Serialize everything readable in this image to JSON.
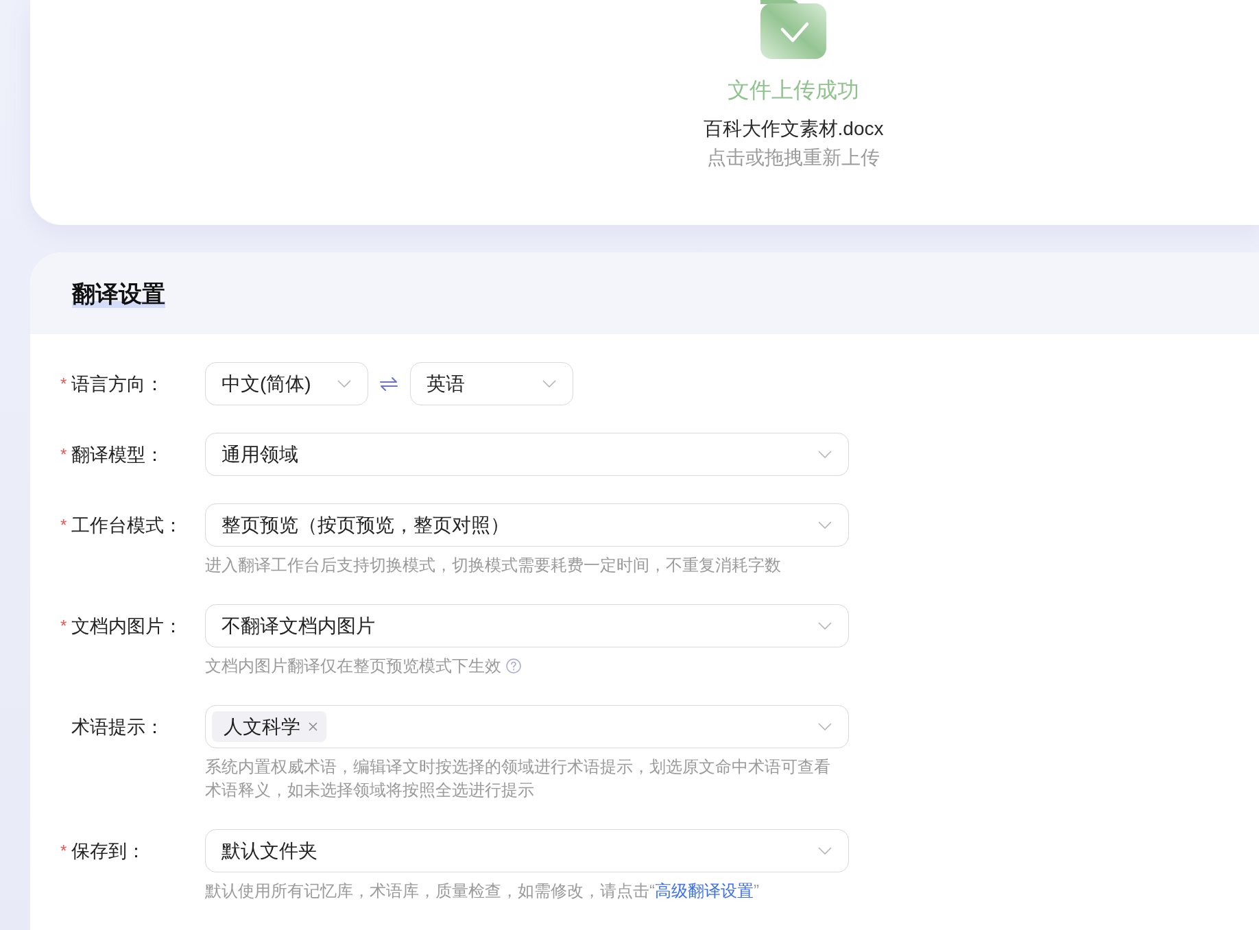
{
  "upload": {
    "status": "文件上传成功",
    "file_name": "百科大作文素材.docx",
    "hint": "点击或拖拽重新上传"
  },
  "settings": {
    "title": "翻译设置",
    "fields": [
      {
        "kind": "language_pair",
        "required_mark": "*",
        "label": "语言方向：",
        "source": "中文(简体)",
        "target": "英语"
      },
      {
        "kind": "select",
        "required_mark": "*",
        "label": "翻译模型：",
        "value": "通用领域"
      },
      {
        "kind": "select",
        "required_mark": "*",
        "label": "工作台模式：",
        "value": "整页预览（按页预览，整页对照）",
        "help": "进入翻译工作台后支持切换模式，切换模式需要耗费一定时间，不重复消耗字数"
      },
      {
        "kind": "select",
        "required_mark": "*",
        "label": "文档内图片：",
        "value": "不翻译文档内图片",
        "help": "文档内图片翻译仅在整页预览模式下生效",
        "help_icon": true
      },
      {
        "kind": "tags",
        "label": "术语提示：",
        "tags": [
          "人文科学"
        ],
        "help": "系统内置权威术语，编辑译文时按选择的领域进行术语提示，划选原文命中术语可查看术语释义，如未选择领域将按照全选进行提示"
      },
      {
        "kind": "select",
        "required_mark": "*",
        "label": "保存到：",
        "value": "默认文件夹",
        "help": "默认使用所有记忆库，术语库，质量检查，如需修改，请点击“",
        "help_link": "高级翻译设置",
        "help_end": "”"
      }
    ]
  }
}
